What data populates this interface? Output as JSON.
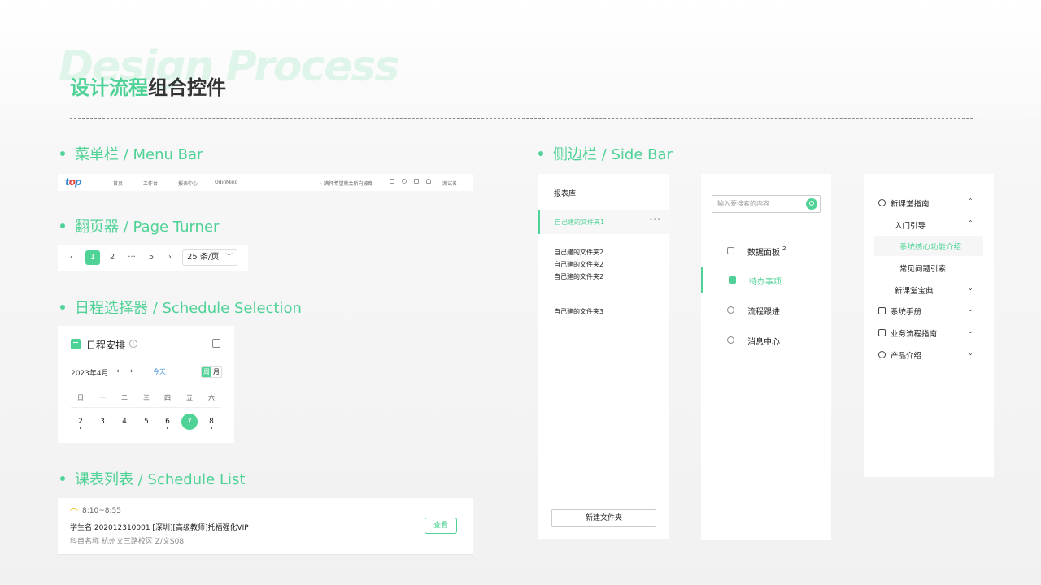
{
  "header": {
    "bg_title": "Design Process",
    "title_green": "设计流程",
    "title_dark": "组合控件"
  },
  "sections": {
    "menu_bar": "菜单栏 / Menu Bar",
    "page_turner": "翻页器 / Page Turner",
    "schedule_selection": "日程选择器 / Schedule Selection",
    "schedule_list": "课表列表 / Schedule List",
    "side_bar": "侧边栏 / Side Bar"
  },
  "menubar": {
    "nav": [
      "首页",
      "工作台",
      "报表中心",
      "OdinMind"
    ],
    "notice": "◦ 满怀希望就会所向披靡",
    "user": "測试名"
  },
  "pager": {
    "prev": "‹",
    "pages": [
      "1",
      "2",
      "···",
      "5"
    ],
    "next": "›",
    "page_size": "25 条/页"
  },
  "schedule": {
    "title": "日程安排",
    "month": "2023年4月",
    "prev": "‹",
    "next": "›",
    "today": "今天",
    "view_week": "周",
    "view_month": "月",
    "weekdays": [
      "日",
      "一",
      "二",
      "三",
      "四",
      "五",
      "六"
    ],
    "days": [
      "2",
      "3",
      "4",
      "5",
      "6",
      "7",
      "8"
    ],
    "selected_day": "7"
  },
  "schedule_list": {
    "time": "8:10~8:55",
    "line1": "学生名   202012310001  [深圳][高级教师]托福强化VIP",
    "line2": "科目名称   杭州文三路校区   Z/文S08",
    "view_button": "查看"
  },
  "sidebar1": {
    "head": "报表库",
    "active_item": "自己建的文件夹1",
    "more": "···",
    "items": [
      "自己建的文件夹2",
      "自己建的文件夹2",
      "自己建的文件夹2",
      "自己建的文件夹3"
    ],
    "new_folder": "新建文件夹"
  },
  "sidebar2": {
    "search_placeholder": "输入要搜索的内容",
    "items": [
      {
        "label": "数据面板",
        "badge": "2"
      },
      {
        "label": "待办事项"
      },
      {
        "label": "流程跟进"
      },
      {
        "label": "消息中心"
      }
    ]
  },
  "sidebar3": {
    "items": [
      {
        "label": "新课堂指南",
        "chevron": "⌃"
      },
      {
        "label": "入门引导",
        "chevron": "⌃"
      },
      {
        "label": "系统核心功能介绍"
      },
      {
        "label": "常见问题引索"
      },
      {
        "label": "新课堂宝典",
        "chevron": "⌄"
      },
      {
        "label": "系统手册",
        "chevron": "⌄"
      },
      {
        "label": "业务流程指南",
        "chevron": "⌄"
      },
      {
        "label": "产品介绍",
        "chevron": "⌄"
      }
    ]
  },
  "colors": {
    "accent": "#4fd295",
    "link": "#3a8bd8"
  }
}
